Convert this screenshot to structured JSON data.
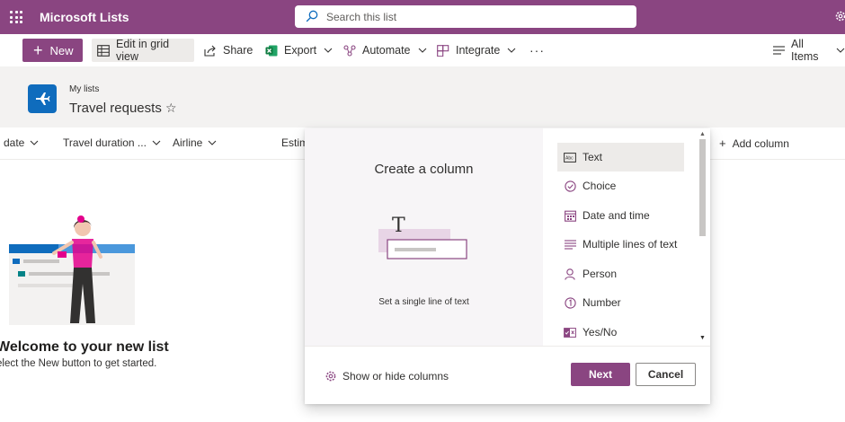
{
  "suite": {
    "app_name": "Microsoft Lists",
    "search_placeholder": "Search this list"
  },
  "command_bar": {
    "new_label": "New",
    "edit_grid_label": "Edit in grid view",
    "share_label": "Share",
    "export_label": "Export",
    "automate_label": "Automate",
    "integrate_label": "Integrate",
    "more_label": "···",
    "view_label": "All Items"
  },
  "header": {
    "breadcrumb": "My lists",
    "title": "Travel requests",
    "favorite_icon": "☆"
  },
  "columns": [
    {
      "label": "date"
    },
    {
      "label": "Travel duration ..."
    },
    {
      "label": "Airline"
    },
    {
      "label": "Estim"
    }
  ],
  "add_column_label": "Add column",
  "empty_state": {
    "title": "Welcome to your new list",
    "subtitle": "elect the New button to get started."
  },
  "create_column_panel": {
    "title": "Create a column",
    "preview_glyph": "T",
    "description": "Set a single line of text",
    "types": [
      {
        "label": "Text",
        "icon": "text-type-icon",
        "selected": true
      },
      {
        "label": "Choice",
        "icon": "choice-icon",
        "selected": false
      },
      {
        "label": "Date and time",
        "icon": "calendar-icon",
        "selected": false
      },
      {
        "label": "Multiple lines of text",
        "icon": "multiline-icon",
        "selected": false
      },
      {
        "label": "Person",
        "icon": "person-icon",
        "selected": false
      },
      {
        "label": "Number",
        "icon": "number-icon",
        "selected": false
      },
      {
        "label": "Yes/No",
        "icon": "yes-no-icon",
        "selected": false
      }
    ],
    "show_hide_label": "Show or hide columns",
    "next_label": "Next",
    "cancel_label": "Cancel"
  },
  "colors": {
    "brand": "#8a4581",
    "list_icon": "#0f6cbd"
  }
}
